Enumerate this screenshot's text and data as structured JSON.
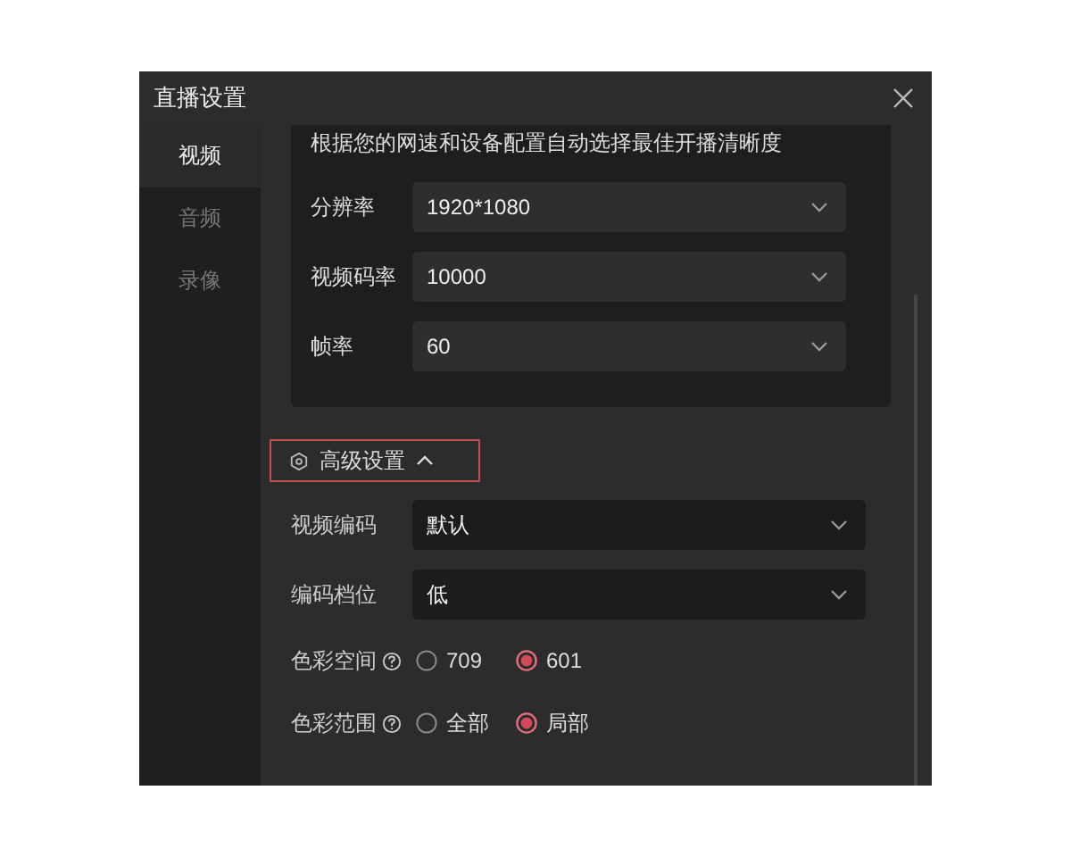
{
  "window": {
    "title": "直播设置"
  },
  "sidebar": {
    "items": [
      {
        "label": "视频",
        "selected": true
      },
      {
        "label": "音频",
        "selected": false
      },
      {
        "label": "录像",
        "selected": false
      }
    ]
  },
  "quality_card": {
    "hint": "根据您的网速和设备配置自动选择最佳开播清晰度",
    "fields": [
      {
        "label": "分辨率",
        "value": "1920*1080"
      },
      {
        "label": "视频码率",
        "value": "10000"
      },
      {
        "label": "帧率",
        "value": "60"
      }
    ]
  },
  "advanced": {
    "title": "高级设置",
    "expanded": true,
    "highlighted": true,
    "fields": [
      {
        "kind": "select",
        "label": "视频编码",
        "value": "默认"
      },
      {
        "kind": "select",
        "label": "编码档位",
        "value": "低"
      },
      {
        "kind": "radio",
        "label": "色彩空间",
        "help": true,
        "options": [
          {
            "label": "709",
            "selected": false
          },
          {
            "label": "601",
            "selected": true
          }
        ]
      },
      {
        "kind": "radio",
        "label": "色彩范围",
        "help": true,
        "options": [
          {
            "label": "全部",
            "selected": false
          },
          {
            "label": "局部",
            "selected": true
          }
        ]
      }
    ]
  }
}
